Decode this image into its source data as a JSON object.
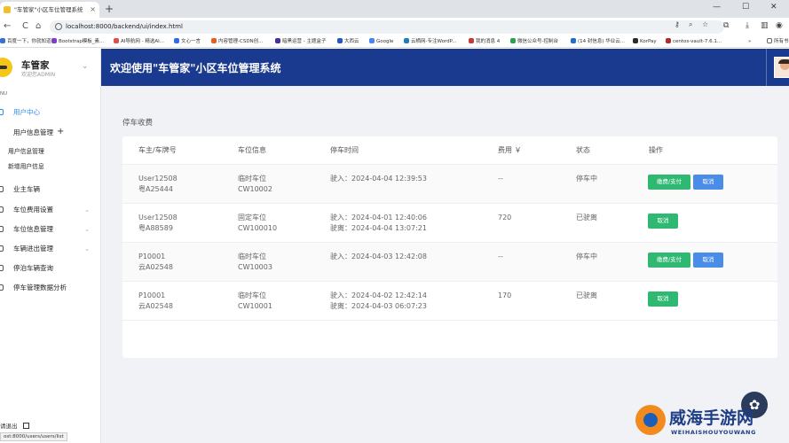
{
  "browser": {
    "tab_title": "\"车管家\"小区车位管理系统",
    "tab_close": "×",
    "new_tab": "+",
    "win_min": "—",
    "win_max": "☐",
    "win_close": "✕",
    "back": "←",
    "forward": "→",
    "reload": "C",
    "home": "⌂",
    "url": "localhost:8000/backend/ui/index.html",
    "bookmarks": [
      "百度一下，你就知道",
      "Bootstrap模板_素...",
      "AI导航网 - 精选AI...",
      "文心一言",
      "内容管理-CSDN创...",
      "暗黑运营 - 主题盒子",
      "大西云",
      "Google",
      "云栖网-专注WordP...",
      "我的消息 4",
      "微信公众号-控制台",
      "(14 封信息) 华业云...",
      "KorPay",
      "centos-vault-7.6.1..."
    ],
    "bookmarks_more": "»",
    "all_bookmarks": "所有书"
  },
  "sidebar": {
    "app_name": "车管家",
    "app_sub": "欢迎您ADMIN",
    "chevron": "⌄",
    "menu_label": "NU",
    "items": [
      {
        "label": "用户中心",
        "active": true
      },
      {
        "label": "用户信息管理",
        "expanded": true
      },
      {
        "label": "业主车辆"
      },
      {
        "label": "车位费用设置",
        "arrow": "⌄"
      },
      {
        "label": "车位信息管理",
        "arrow": "⌄"
      },
      {
        "label": "车辆进出管理",
        "arrow": "⌄"
      },
      {
        "label": "停泊车辆查询"
      },
      {
        "label": "停车管理数据分析"
      }
    ],
    "plus": "+",
    "sub_items": [
      "用户信息管理",
      "新增用户信息"
    ],
    "footer": "请退出",
    "status_url": "ost:8000/users/users/list"
  },
  "header": {
    "title": "欢迎使用\"车管家\"小区车位管理系统"
  },
  "main": {
    "section_title": "停车收费",
    "columns": [
      "车主/车牌号",
      "车位信息",
      "停车时间",
      "费用 ￥",
      "状态",
      "操作"
    ],
    "rows": [
      {
        "owner": "User12508",
        "plate": "粤A25444",
        "slot_type": "临时车位",
        "slot_id": "CW10002",
        "time_in": "驶入：2024-04-04 12:39:53",
        "time_out": "",
        "fee": "--",
        "status": "停车中",
        "actions": [
          "缴费/支付",
          "取消"
        ]
      },
      {
        "owner": "User12508",
        "plate": "粤A88589",
        "slot_type": "固定车位",
        "slot_id": "CW100010",
        "time_in": "驶入：2024-04-01 12:40:06",
        "time_out": "驶离：2024-04-04 13:07:21",
        "fee": "720",
        "status": "已驶离",
        "actions": [
          "取消"
        ]
      },
      {
        "owner": "P10001",
        "plate": "云A02548",
        "slot_type": "临时车位",
        "slot_id": "CW10003",
        "time_in": "驶入：2024-04-03 12:42:08",
        "time_out": "",
        "fee": "--",
        "status": "停车中",
        "actions": [
          "缴费/支付",
          "取消"
        ]
      },
      {
        "owner": "P10001",
        "plate": "云A02548",
        "slot_type": "临时车位",
        "slot_id": "CW10001",
        "time_in": "驶入：2024-04-02 12:42:14",
        "time_out": "驶离：2024-04-03 06:07:23",
        "fee": "170",
        "status": "已驶离",
        "actions": [
          "取消"
        ]
      }
    ]
  },
  "fab_icon": "✿",
  "watermark": {
    "text": "威海手游网",
    "sub": "WEIHAISHOUYOUWANG"
  },
  "colors": {
    "header_bg": "#1a3a8f",
    "active": "#2d8cf0",
    "green_btn": "#2eb872",
    "blue_btn": "#4a8de8"
  }
}
